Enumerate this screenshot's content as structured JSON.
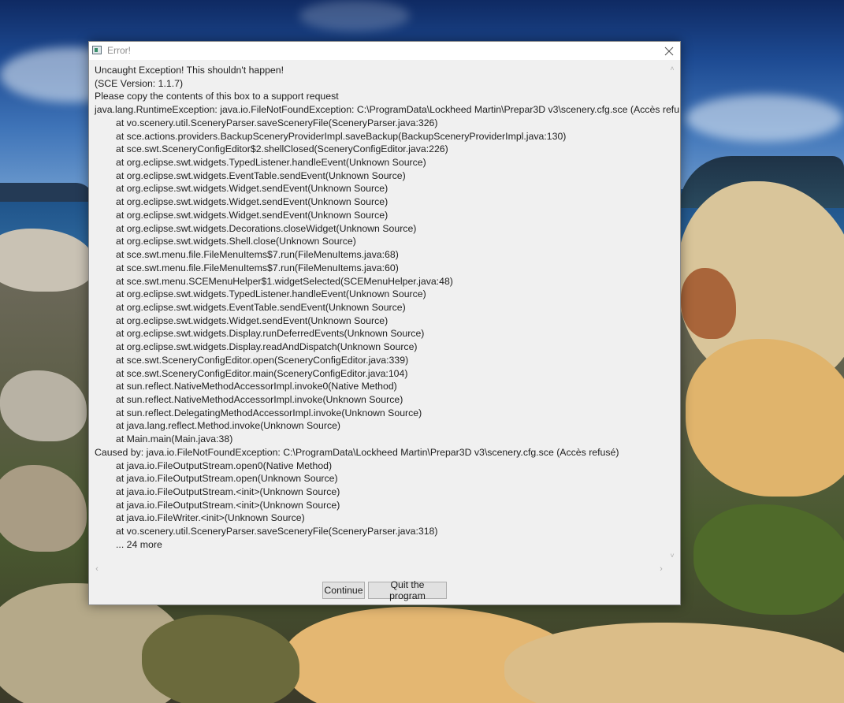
{
  "window": {
    "title": "Error!",
    "close_icon": "close-icon",
    "app_icon": "java-app-icon"
  },
  "message": {
    "lines": [
      {
        "text": "Uncaught Exception! This shouldn't happen!",
        "indent": false
      },
      {
        "text": "(SCE Version: 1.1.7)",
        "indent": false
      },
      {
        "text": "Please copy the contents of this box to a support request",
        "indent": false
      },
      {
        "text": "java.lang.RuntimeException: java.io.FileNotFoundException: C:\\ProgramData\\Lockheed Martin\\Prepar3D v3\\scenery.cfg.sce (Accès refusé)",
        "indent": false
      },
      {
        "text": "at vo.scenery.util.SceneryParser.saveSceneryFile(SceneryParser.java:326)",
        "indent": true
      },
      {
        "text": "at sce.actions.providers.BackupSceneryProviderImpl.saveBackup(BackupSceneryProviderImpl.java:130)",
        "indent": true
      },
      {
        "text": "at sce.swt.SceneryConfigEditor$2.shellClosed(SceneryConfigEditor.java:226)",
        "indent": true
      },
      {
        "text": "at org.eclipse.swt.widgets.TypedListener.handleEvent(Unknown Source)",
        "indent": true
      },
      {
        "text": "at org.eclipse.swt.widgets.EventTable.sendEvent(Unknown Source)",
        "indent": true
      },
      {
        "text": "at org.eclipse.swt.widgets.Widget.sendEvent(Unknown Source)",
        "indent": true
      },
      {
        "text": "at org.eclipse.swt.widgets.Widget.sendEvent(Unknown Source)",
        "indent": true
      },
      {
        "text": "at org.eclipse.swt.widgets.Widget.sendEvent(Unknown Source)",
        "indent": true
      },
      {
        "text": "at org.eclipse.swt.widgets.Decorations.closeWidget(Unknown Source)",
        "indent": true
      },
      {
        "text": "at org.eclipse.swt.widgets.Shell.close(Unknown Source)",
        "indent": true
      },
      {
        "text": "at sce.swt.menu.file.FileMenuItems$7.run(FileMenuItems.java:68)",
        "indent": true
      },
      {
        "text": "at sce.swt.menu.file.FileMenuItems$7.run(FileMenuItems.java:60)",
        "indent": true
      },
      {
        "text": "at sce.swt.menu.SCEMenuHelper$1.widgetSelected(SCEMenuHelper.java:48)",
        "indent": true
      },
      {
        "text": "at org.eclipse.swt.widgets.TypedListener.handleEvent(Unknown Source)",
        "indent": true
      },
      {
        "text": "at org.eclipse.swt.widgets.EventTable.sendEvent(Unknown Source)",
        "indent": true
      },
      {
        "text": "at org.eclipse.swt.widgets.Widget.sendEvent(Unknown Source)",
        "indent": true
      },
      {
        "text": "at org.eclipse.swt.widgets.Display.runDeferredEvents(Unknown Source)",
        "indent": true
      },
      {
        "text": "at org.eclipse.swt.widgets.Display.readAndDispatch(Unknown Source)",
        "indent": true
      },
      {
        "text": "at sce.swt.SceneryConfigEditor.open(SceneryConfigEditor.java:339)",
        "indent": true
      },
      {
        "text": "at sce.swt.SceneryConfigEditor.main(SceneryConfigEditor.java:104)",
        "indent": true
      },
      {
        "text": "at sun.reflect.NativeMethodAccessorImpl.invoke0(Native Method)",
        "indent": true
      },
      {
        "text": "at sun.reflect.NativeMethodAccessorImpl.invoke(Unknown Source)",
        "indent": true
      },
      {
        "text": "at sun.reflect.DelegatingMethodAccessorImpl.invoke(Unknown Source)",
        "indent": true
      },
      {
        "text": "at java.lang.reflect.Method.invoke(Unknown Source)",
        "indent": true
      },
      {
        "text": "at Main.main(Main.java:38)",
        "indent": true
      },
      {
        "text": "Caused by: java.io.FileNotFoundException: C:\\ProgramData\\Lockheed Martin\\Prepar3D v3\\scenery.cfg.sce (Accès refusé)",
        "indent": false
      },
      {
        "text": "at java.io.FileOutputStream.open0(Native Method)",
        "indent": true
      },
      {
        "text": "at java.io.FileOutputStream.open(Unknown Source)",
        "indent": true
      },
      {
        "text": "at java.io.FileOutputStream.<init>(Unknown Source)",
        "indent": true
      },
      {
        "text": "at java.io.FileOutputStream.<init>(Unknown Source)",
        "indent": true
      },
      {
        "text": "at java.io.FileWriter.<init>(Unknown Source)",
        "indent": true
      },
      {
        "text": "at vo.scenery.util.SceneryParser.saveSceneryFile(SceneryParser.java:318)",
        "indent": true
      },
      {
        "text": "... 24 more",
        "indent": true
      }
    ]
  },
  "scrollbars": {
    "up_icon": "scroll-up-arrow-icon",
    "down_icon": "scroll-down-arrow-icon",
    "left_icon": "scroll-left-arrow-icon",
    "right_icon": "scroll-right-arrow-icon"
  },
  "buttons": {
    "continue_label": "Continue",
    "quit_label": "Quit the program"
  },
  "colors": {
    "dialog_bg": "#f0f0f0",
    "titlebar_bg": "#ffffff",
    "button_bg": "#e1e1e1",
    "button_border": "#adadad"
  }
}
